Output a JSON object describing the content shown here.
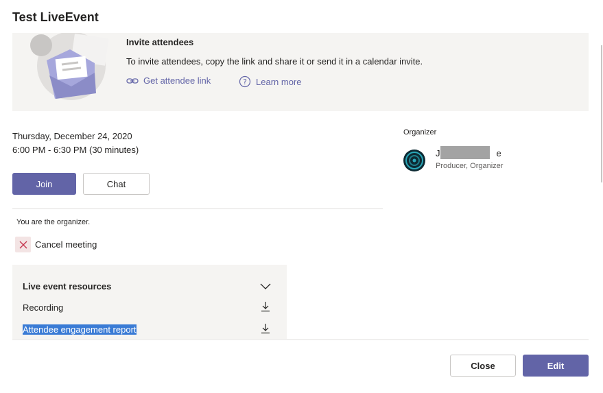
{
  "dialog": {
    "title": "Test LiveEvent"
  },
  "invite": {
    "title": "Invite attendees",
    "description": "To invite attendees, copy the link and share it or send it in a calendar invite.",
    "get_link_label": "Get attendee link",
    "learn_more_label": "Learn more"
  },
  "schedule": {
    "date": "Thursday, December 24, 2020",
    "time": "6:00 PM - 6:30 PM (30 minutes)"
  },
  "actions": {
    "join_label": "Join",
    "chat_label": "Chat"
  },
  "organizer_note": "You are the organizer.",
  "cancel_label": "Cancel meeting",
  "resources": {
    "header": "Live event resources",
    "items": [
      {
        "label": "Recording",
        "selected": false
      },
      {
        "label": "Attendee engagement report",
        "selected": true
      }
    ]
  },
  "organizer": {
    "label": "Organizer",
    "name_first": "J",
    "name_last": "e",
    "role": "Producer, Organizer"
  },
  "footer": {
    "close_label": "Close",
    "edit_label": "Edit"
  },
  "colors": {
    "accent": "#6264a7",
    "panel": "#f5f4f2",
    "selection": "#3a7bd5"
  }
}
